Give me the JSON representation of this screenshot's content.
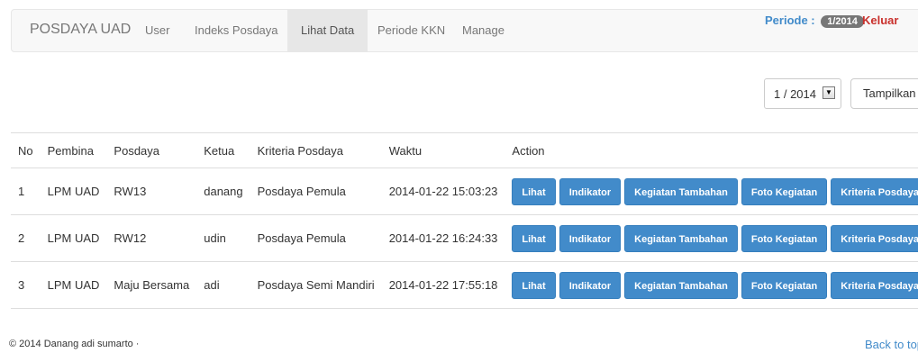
{
  "navbar": {
    "brand": "POSDAYA UAD",
    "items": [
      "User",
      "Indeks Posdaya",
      "Lihat Data",
      "Periode KKN",
      "Manage"
    ],
    "active_item": "Lihat Data",
    "periode_label": "Periode :",
    "periode_value": "1/2014",
    "logout_label": "Keluar"
  },
  "filter": {
    "selected_period": "1 / 2014",
    "button_label": "Tampilkan"
  },
  "table": {
    "headers": [
      "No",
      "Pembina",
      "Posdaya",
      "Ketua",
      "Kriteria Posdaya",
      "Waktu",
      "Action"
    ],
    "rows": [
      {
        "no": "1",
        "pembina": "LPM UAD",
        "posdaya": "RW13",
        "ketua": "danang",
        "kriteria": "Posdaya Pemula",
        "waktu": "2014-01-22 15:03:23"
      },
      {
        "no": "2",
        "pembina": "LPM UAD",
        "posdaya": "RW12",
        "ketua": "udin",
        "kriteria": "Posdaya Pemula",
        "waktu": "2014-01-22 16:24:33"
      },
      {
        "no": "3",
        "pembina": "LPM UAD",
        "posdaya": "Maju Bersama",
        "ketua": "adi",
        "kriteria": "Posdaya Semi Mandiri",
        "waktu": "2014-01-22 17:55:18"
      }
    ],
    "action_buttons": [
      "Lihat",
      "Indikator",
      "Kegiatan Tambahan",
      "Foto Kegiatan",
      "Kriteria Posdaya"
    ]
  },
  "footer": {
    "copyright": "© 2014 Danang adi sumarto ·",
    "back_to_top": "Back to top"
  },
  "colors": {
    "primary": "#428bca",
    "danger": "#c9302c",
    "navbar_bg": "#f8f8f8",
    "badge_bg": "#777777"
  }
}
